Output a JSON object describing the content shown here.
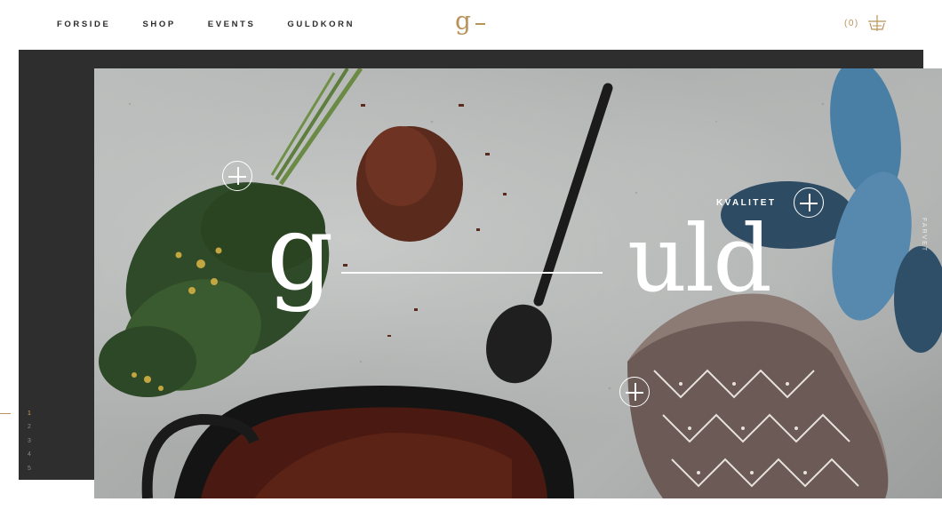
{
  "nav": {
    "items": [
      "FORSIDE",
      "SHOP",
      "EVENTS",
      "GULDKORN"
    ]
  },
  "logo": {
    "letter": "g"
  },
  "cart": {
    "count": "(0)",
    "icon": "basket-icon"
  },
  "hero": {
    "headline_left": "g",
    "headline_right": "uld",
    "hotspot_label": "KVALITET",
    "vertical_text": "FARVET"
  },
  "slider": {
    "pages": [
      "1",
      "2",
      "3",
      "4",
      "5"
    ],
    "active_index": 0
  },
  "colors": {
    "accent": "#b8935a",
    "dark_panel": "#2e2e2e"
  }
}
